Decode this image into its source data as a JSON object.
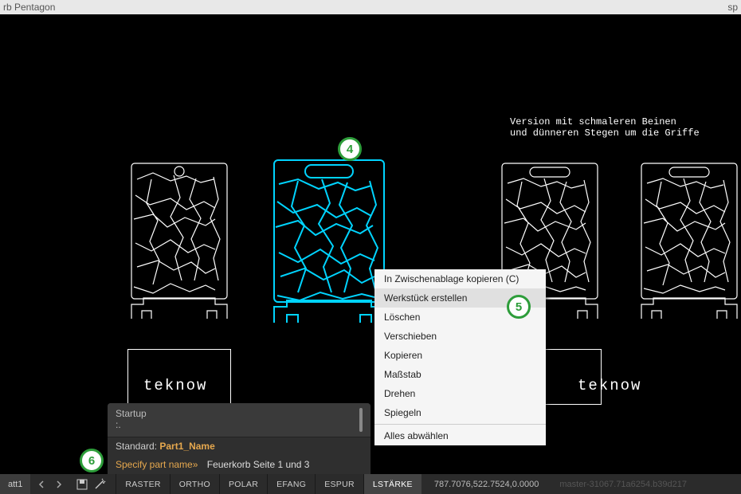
{
  "titlebar": {
    "left": "rb Pentagon",
    "right": "sp"
  },
  "annotation": "Version mit schmaleren Beinen\nund dünneren Stegen um die Griffe",
  "brand": "teknow",
  "callouts": {
    "c4": "4",
    "c5": "5",
    "c6": "6"
  },
  "context_menu": {
    "items": [
      "In Zwischenablage kopieren (C)",
      "Werkstück erstellen",
      "Löschen",
      "Verschieben",
      "Kopieren",
      "Maßstab",
      "Drehen",
      "Spiegeln"
    ],
    "last": "Alles abwählen"
  },
  "cmd": {
    "history": "Startup\n:.",
    "hint_label": "Standard: ",
    "hint_value": "Part1_Name",
    "prompt": "Specify part name»",
    "entered": "Feuerkorb Seite 1 und 3"
  },
  "statusbar": {
    "tab": "att1",
    "toggles": [
      "RASTER",
      "ORTHO",
      "POLAR",
      "EFANG",
      "ESPUR",
      "LSTÄRKE"
    ],
    "active_toggle": "LSTÄRKE",
    "coords": "787.7076,522.7524,0.0000",
    "build": "master-31067.71a6254.b39d217"
  }
}
